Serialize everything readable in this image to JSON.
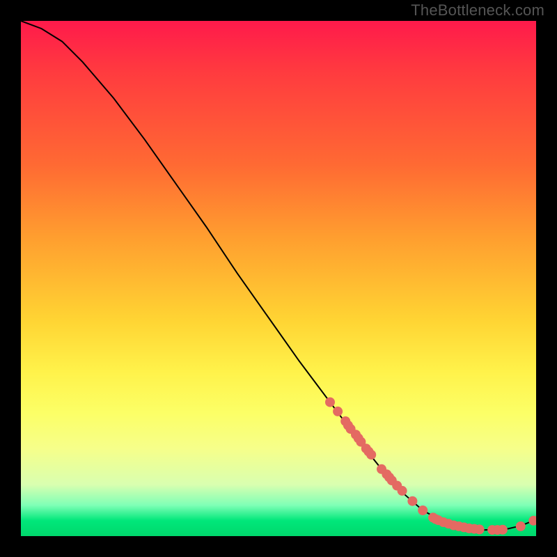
{
  "watermark": "TheBottleneck.com",
  "chart_data": {
    "type": "line",
    "title": "",
    "xlabel": "",
    "ylabel": "",
    "xlim": [
      0,
      100
    ],
    "ylim": [
      0,
      100
    ],
    "curve": {
      "x": [
        0,
        4,
        8,
        12,
        18,
        24,
        30,
        36,
        42,
        48,
        54,
        60,
        66,
        70,
        74,
        78,
        82,
        86,
        90,
        94,
        97,
        100
      ],
      "y": [
        100,
        98.5,
        96,
        92,
        85,
        77,
        68.5,
        60,
        51,
        42.5,
        34,
        26,
        18,
        13,
        8.5,
        5,
        2.8,
        1.6,
        1.2,
        1.3,
        2,
        3.2
      ]
    },
    "series": [
      {
        "name": "points",
        "color": "#e46a62",
        "x": [
          60,
          61.5,
          63,
          63.5,
          64,
          65,
          65.5,
          66,
          67,
          67.5,
          68,
          70,
          71,
          71.5,
          72,
          73,
          74,
          76,
          78,
          80,
          80.5,
          81,
          82,
          83,
          84,
          85,
          86,
          87,
          88,
          89,
          91.5,
          92.5,
          93.5,
          97,
          99.5
        ],
        "y": [
          26,
          24.2,
          22.3,
          21.5,
          20.8,
          19.7,
          19,
          18.3,
          17,
          16.4,
          15.8,
          13,
          12,
          11.4,
          10.8,
          9.8,
          8.8,
          6.8,
          5,
          3.6,
          3.3,
          3.1,
          2.7,
          2.4,
          2.1,
          1.9,
          1.7,
          1.5,
          1.4,
          1.3,
          1.2,
          1.2,
          1.25,
          1.9,
          3.0
        ]
      }
    ]
  }
}
